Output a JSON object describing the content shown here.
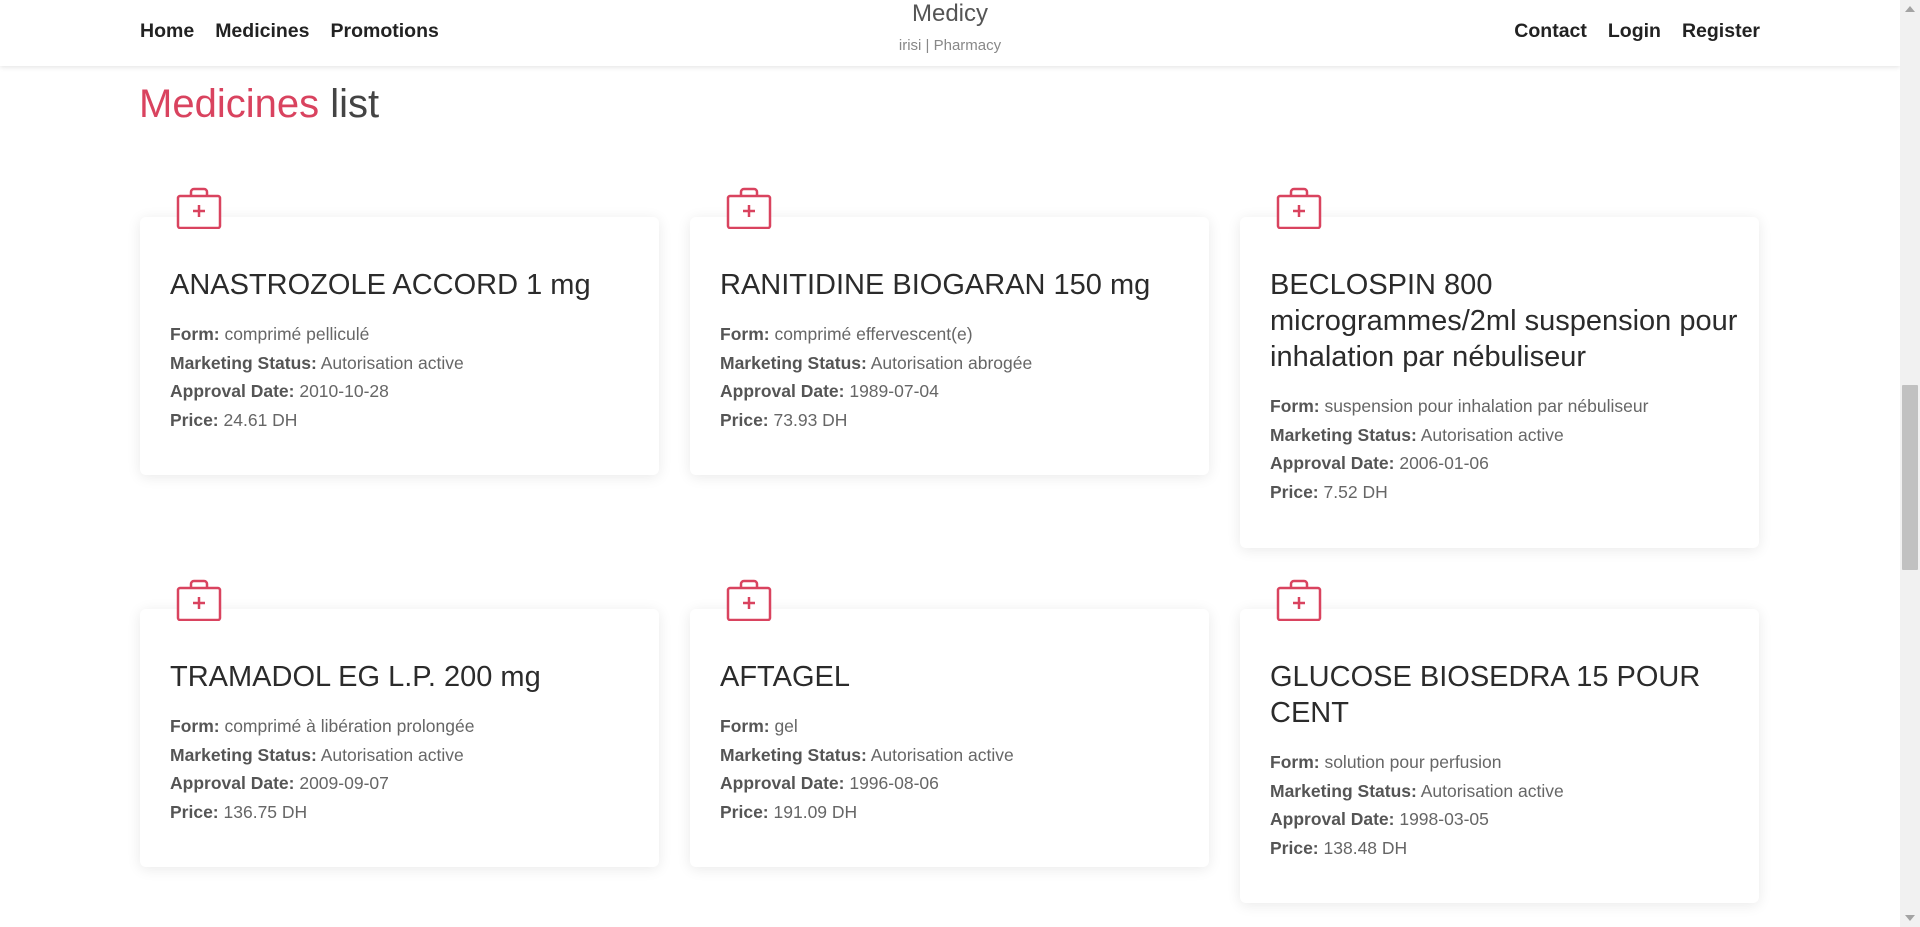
{
  "nav": {
    "left": [
      "Home",
      "Medicines",
      "Promotions"
    ],
    "right": [
      "Contact",
      "Login",
      "Register"
    ],
    "brand_title": "Medicy",
    "brand_sub": "irisi | Pharmacy"
  },
  "heading": {
    "accent": "Medicines",
    "rest": "list"
  },
  "labels": {
    "form": "Form:",
    "status": "Marketing Status:",
    "date": "Approval Date:",
    "price": "Price:"
  },
  "icons": {
    "card_icon": "medical-kit-icon"
  },
  "colors": {
    "accent": "#d9435f"
  },
  "medicines": [
    {
      "name": "ANASTROZOLE ACCORD 1 mg",
      "form": "comprimé pelliculé",
      "status": "Autorisation active",
      "date": "2010-10-28",
      "price": "24.61 DH"
    },
    {
      "name": "RANITIDINE BIOGARAN 150 mg",
      "form": "comprimé effervescent(e)",
      "status": "Autorisation abrogée",
      "date": "1989-07-04",
      "price": "73.93 DH"
    },
    {
      "name": "BECLOSPIN 800 microgrammes/2ml suspension pour inhalation par nébuliseur",
      "form": "suspension pour inhalation par nébuliseur",
      "status": "Autorisation active",
      "date": "2006-01-06",
      "price": "7.52 DH"
    },
    {
      "name": "TRAMADOL EG L.P. 200 mg",
      "form": "comprimé à libération prolongée",
      "status": "Autorisation active",
      "date": "2009-09-07",
      "price": "136.75 DH"
    },
    {
      "name": "AFTAGEL",
      "form": "gel",
      "status": "Autorisation active",
      "date": "1996-08-06",
      "price": "191.09 DH"
    },
    {
      "name": "GLUCOSE BIOSEDRA 15 POUR CENT",
      "form": "solution pour perfusion",
      "status": "Autorisation active",
      "date": "1998-03-05",
      "price": "138.48 DH"
    }
  ]
}
